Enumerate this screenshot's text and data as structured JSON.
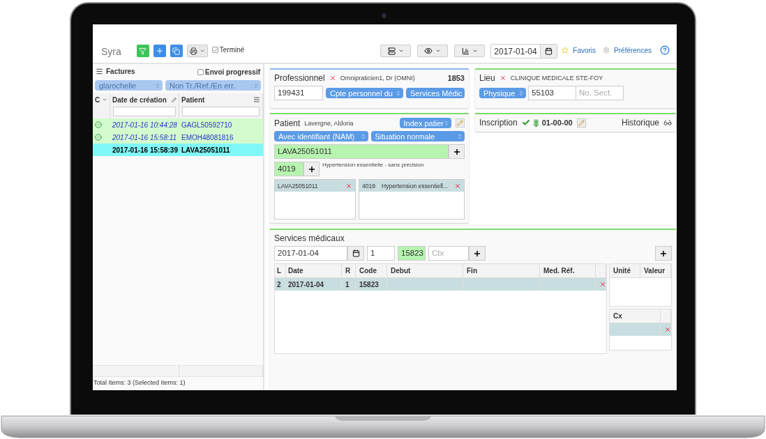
{
  "toolbar": {
    "app_name": "Syra",
    "done_checkbox": {
      "label": "Terminé",
      "checked": true
    },
    "date": "2017-01-04",
    "favorites": "Favoris",
    "preferences": "Préférences"
  },
  "invoices": {
    "title": "Factures",
    "progressive": {
      "label": "Envoi progressif",
      "checked": false
    },
    "user_select": "glarochelle",
    "status_select": "Non Tr./Ref./En err.",
    "columns": [
      "C",
      "Date de création",
      "Patient"
    ],
    "rows": [
      {
        "done": true,
        "date": "2017-01-16 10:44:28",
        "patient": "GAGL50592710",
        "selected": false
      },
      {
        "done": true,
        "date": "2017-01-16 15:58:11",
        "patient": "EMOH48081816",
        "selected": false
      },
      {
        "done": false,
        "date": "2017-01-16 15:58:39",
        "patient": "LAVA25051011",
        "selected": true
      }
    ],
    "total": "Total Items: 3 (Selected Items: 1)"
  },
  "professional": {
    "title": "Professionnel",
    "name": "Omnipraticien1, Dr (OMNI)",
    "number": "1853",
    "id": "199431",
    "account": "Cpte personnel du",
    "service": "Services Médic"
  },
  "location": {
    "title": "Lieu",
    "name": "CLINIQUE MEDICALE STE-FOY",
    "type": "Physique",
    "number": "55103",
    "sector_placeholder": "No. Sect."
  },
  "patient": {
    "title": "Patient",
    "name": "Lavergne, Aldoria",
    "index": "Index patier",
    "id_type": "Avec identifiant (NAM)",
    "situation": "Situation normale",
    "nam": "LAVA25051011",
    "diagnosis_code": "4019",
    "diagnosis": "Hypertension essentielle - sans précision",
    "nam_list": [
      {
        "text": "LAVA25051011"
      }
    ],
    "diagnosis_list": [
      {
        "code": "4019",
        "text": "Hypertension essentiell..."
      }
    ]
  },
  "registration": {
    "title": "Inscription",
    "valid": true,
    "code": "01-00-00",
    "history": "Historique"
  },
  "services": {
    "title": "Services médicaux",
    "date": "2017-01-04",
    "role": "1",
    "code": "15823",
    "context_placeholder": "Ctx",
    "columns": [
      "L",
      "Date",
      "R",
      "Code",
      "Debut",
      "Fin",
      "Med. Réf."
    ],
    "rows": [
      {
        "line": "2",
        "date": "2017-01-04",
        "role": "1",
        "code": "15823",
        "selected": true
      }
    ],
    "unit_columns": [
      "Unité",
      "Valeur"
    ],
    "context_columns": [
      "Cx"
    ],
    "context_rows": [
      {
        "selected": true
      }
    ]
  }
}
